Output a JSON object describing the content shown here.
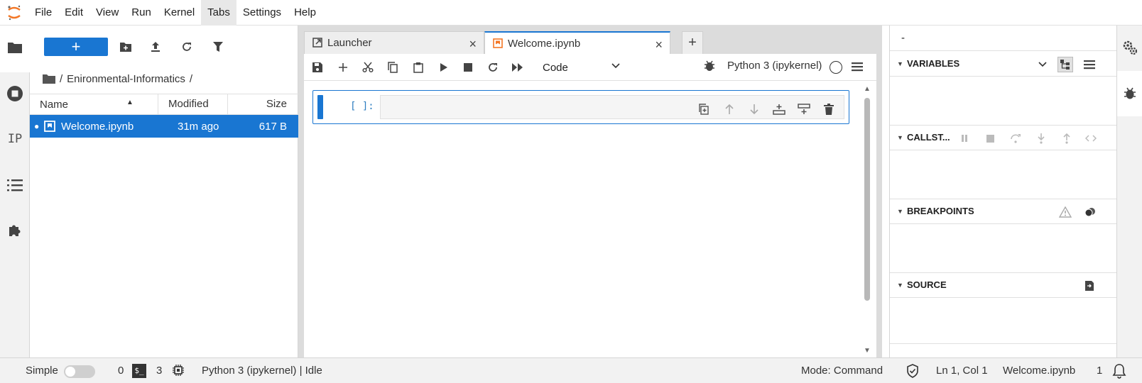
{
  "menubar": {
    "items": [
      "File",
      "Edit",
      "View",
      "Run",
      "Kernel",
      "Tabs",
      "Settings",
      "Help"
    ],
    "active_index": 5
  },
  "leftbar": {
    "icons": [
      "folder-icon",
      "running-icon",
      "property-inspector-icon",
      "table-of-contents-icon",
      "extension-icon"
    ],
    "ip_label": "IP"
  },
  "filebrowser": {
    "new_button_label": "+",
    "breadcrumb": {
      "root_sep": "/",
      "folder": "Enironmental-Informatics",
      "trail_sep": "/"
    },
    "columns": {
      "name": "Name",
      "modified": "Modified",
      "size": "Size"
    },
    "files": [
      {
        "name": "Welcome.ipynb",
        "modified": "31m ago",
        "size": "617 B",
        "selected": true
      }
    ]
  },
  "tabs": [
    {
      "label": "Launcher",
      "close": "×",
      "active": false
    },
    {
      "label": "Welcome.ipynb",
      "close": "×",
      "active": true
    }
  ],
  "tab_add": "+",
  "notebook": {
    "cell_type": "Code",
    "kernel_name": "Python 3 (ipykernel)",
    "cell_prompt": "[ ]:"
  },
  "debugger": {
    "top_text": "-",
    "sections": {
      "variables": "VARIABLES",
      "callstack": "CALLST...",
      "breakpoints": "BREAKPOINTS",
      "source": "SOURCE"
    }
  },
  "statusbar": {
    "mode_label": "Simple",
    "kernels_count": "0",
    "terminal_label": "$_",
    "terminals_count": "3",
    "kernel_status": "Python 3 (ipykernel) | Idle",
    "mode": "Mode: Command",
    "cursor": "Ln 1, Col 1",
    "file": "Welcome.ipynb",
    "notifications": "1"
  },
  "colors": {
    "accent": "#1976d2",
    "logo": "#f37726"
  }
}
